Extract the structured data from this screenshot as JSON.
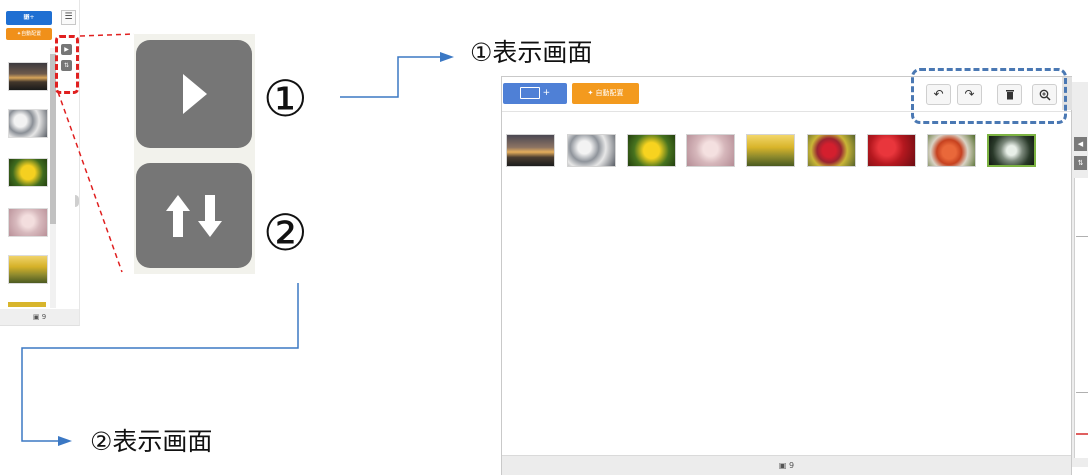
{
  "left_panel": {
    "add_button_label": "⃵+",
    "auto_button_label": "✦自動配置",
    "list_icon": "list-icon",
    "image_count": "9",
    "controls": [
      "play-icon",
      "sort-icon"
    ]
  },
  "callouts": {
    "one_marker": "①",
    "two_marker": "②",
    "one_label": "①表示画面",
    "two_label": "②表示画面"
  },
  "right_panel": {
    "add_button_label": "+",
    "auto_button_label": "自動配置",
    "tools": [
      "undo-icon",
      "redo-icon",
      "trash-icon",
      "zoom-in-icon"
    ],
    "image_count": "9",
    "thumbnails": [
      "sunset",
      "cherry-blossom",
      "yellow-flowers",
      "pink-blossom",
      "ginkgo-avenue",
      "red-flowers",
      "autumn-leaves",
      "persimmons",
      "waterfall"
    ]
  },
  "colors": {
    "highlight_red": "#e02020",
    "highlight_blue": "#4a78b3",
    "callout_line": "#3b78c4",
    "add_blue": "#4f80d6",
    "auto_orange": "#f39a1e"
  }
}
